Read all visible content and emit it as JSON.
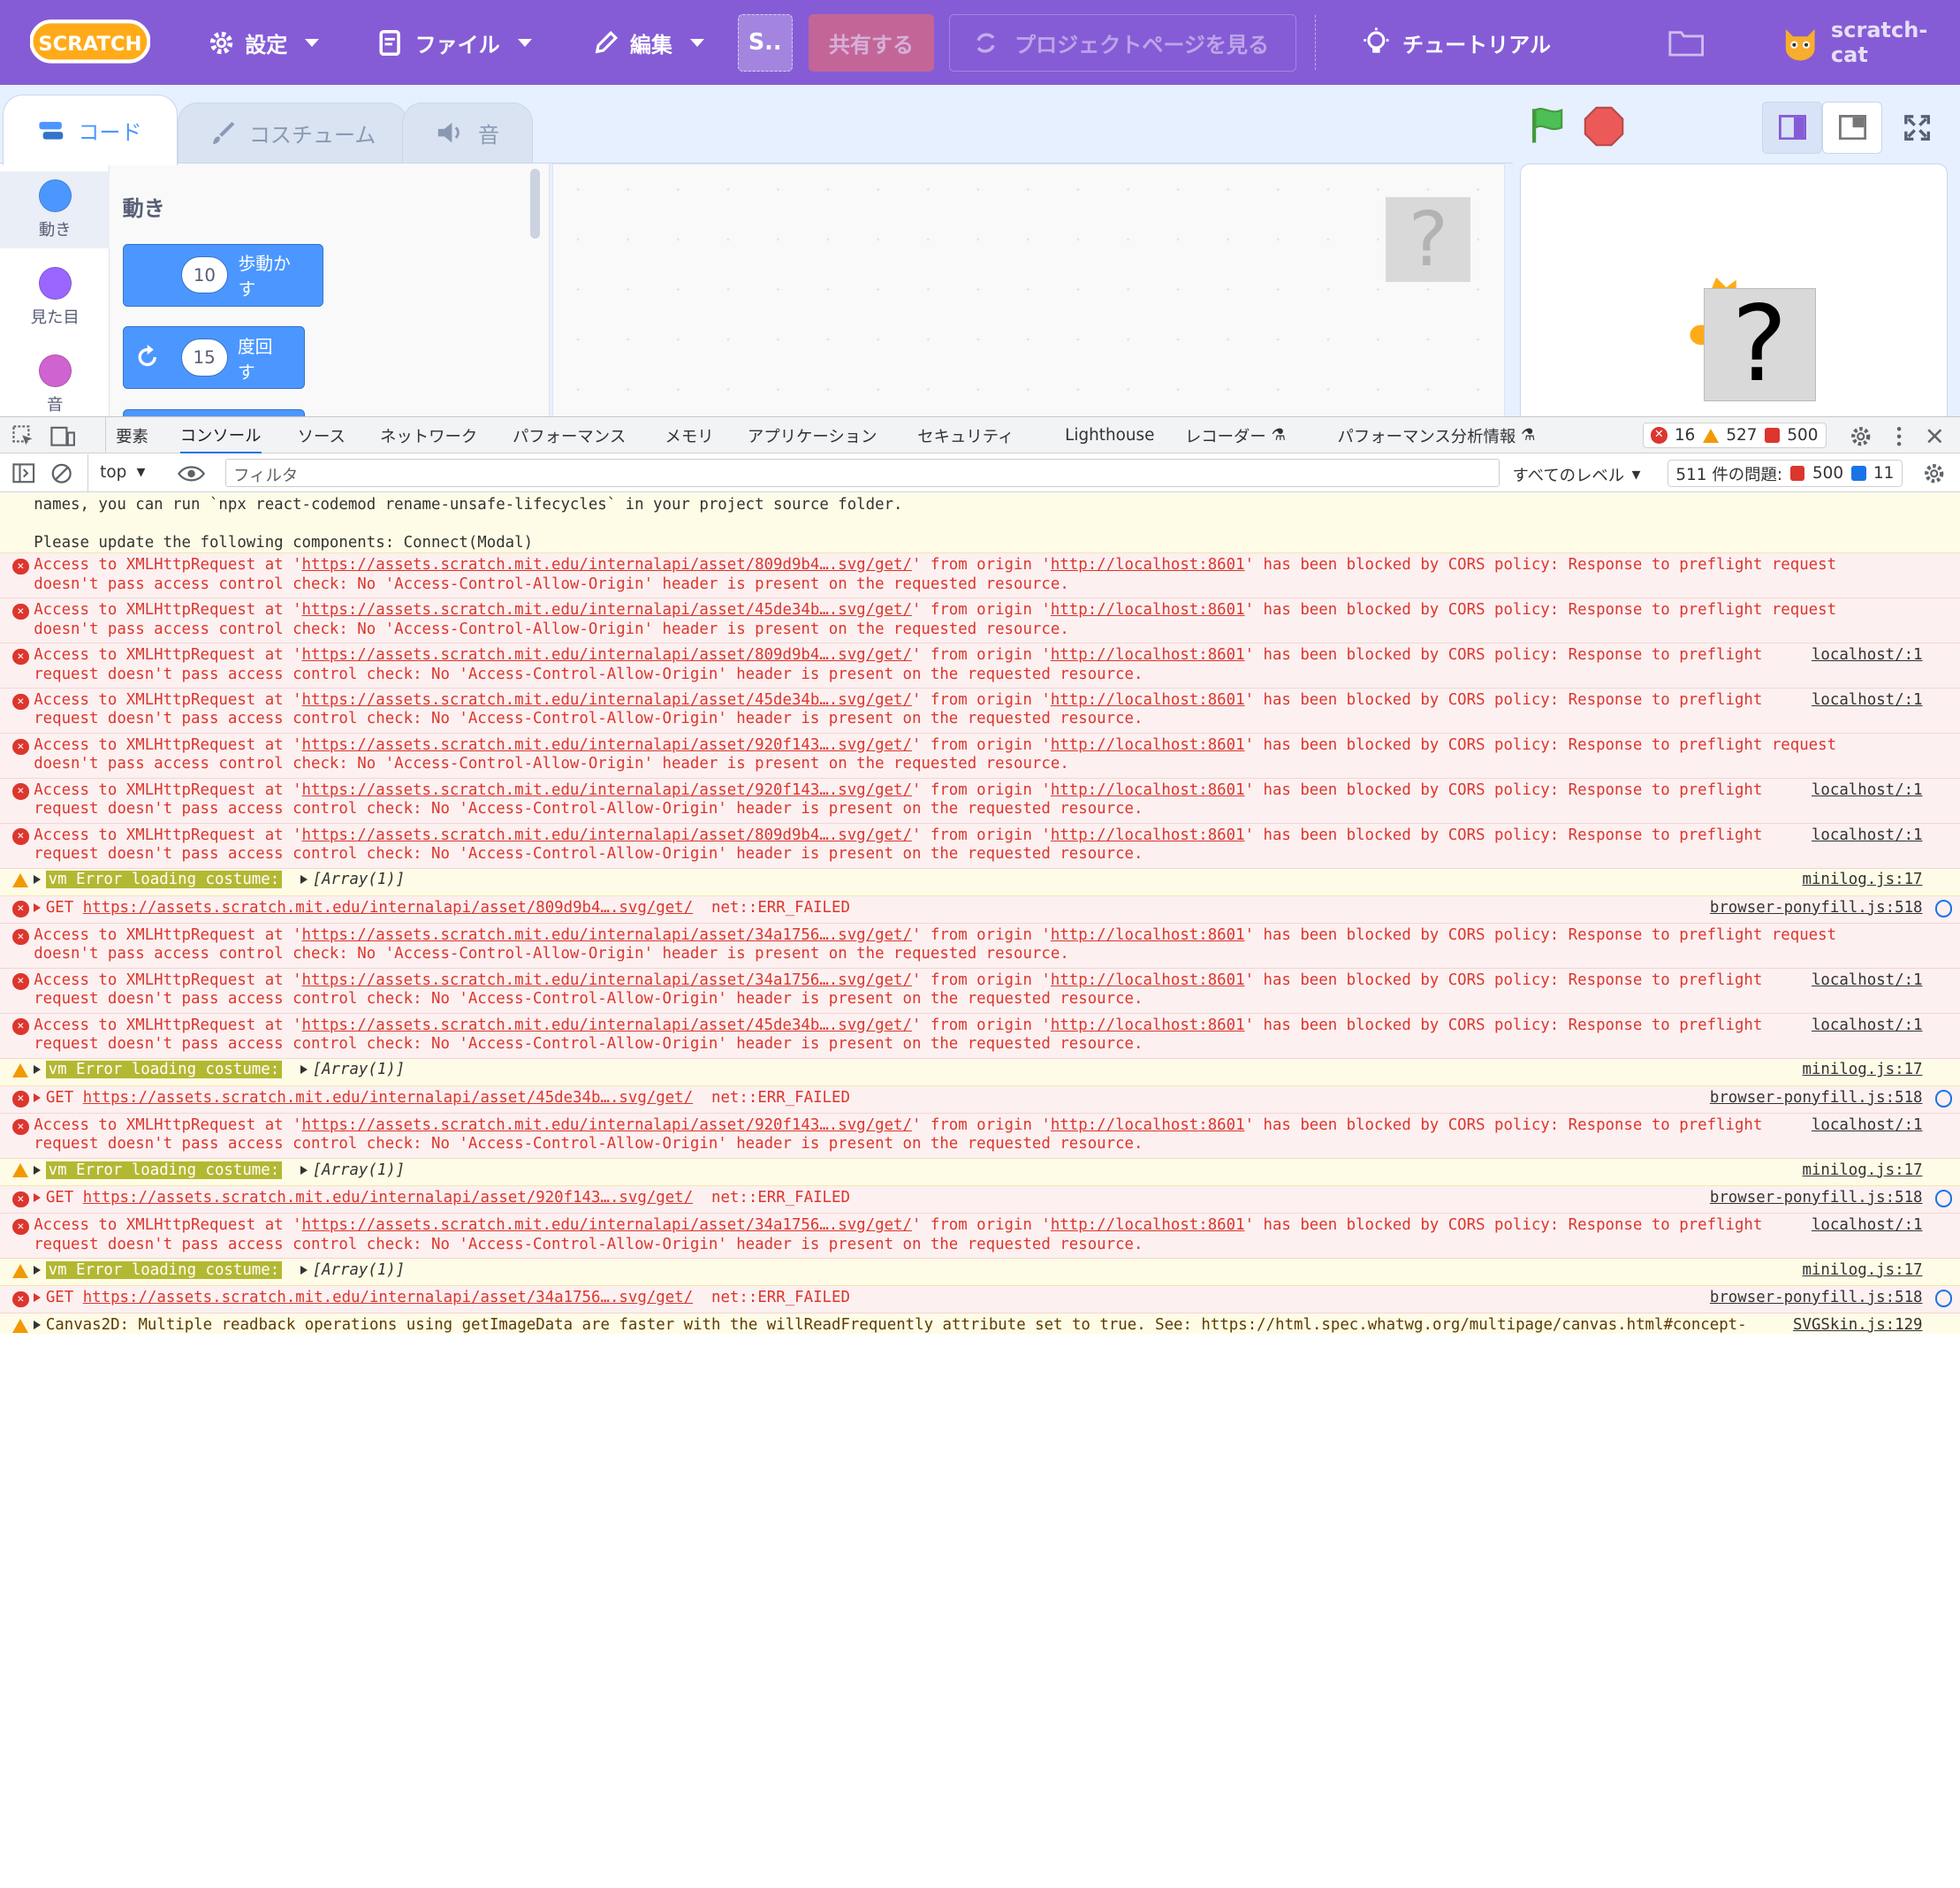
{
  "menubar": {
    "logo": "SCRATCH",
    "settings": "設定",
    "file": "ファイル",
    "edit": "編集",
    "project_short": "S..",
    "share": "共有する",
    "project_page": "プロジェクトページを見る",
    "tutorial": "チュートリアル",
    "username": "scratch-cat",
    "colors": {
      "bar": "#855cd6"
    }
  },
  "tabs": [
    "コード",
    "コスチューム",
    "音"
  ],
  "categories": [
    {
      "label": "動き",
      "color": "#4c97ff"
    },
    {
      "label": "見た目",
      "color": "#9966ff"
    },
    {
      "label": "音",
      "color": "#cf63cf"
    }
  ],
  "palette": {
    "title": "動き",
    "blocks": [
      {
        "num": "10",
        "label": "歩動かす"
      },
      {
        "num": "15",
        "label": "度回す"
      }
    ]
  },
  "placeholder_glyph": "?",
  "devtools": {
    "tabs": [
      "要素",
      "コンソール",
      "ソース",
      "ネットワーク",
      "パフォーマンス",
      "メモリ",
      "アプリケーション",
      "セキュリティ",
      "Lighthouse",
      "レコーダー",
      "パフォーマンス分析情報"
    ],
    "error_count": "16",
    "warning_count": "527",
    "issue_count": "500",
    "context": "top",
    "filter_placeholder": "フィルタ",
    "levels": "すべてのレベル",
    "issues_label": "511 件の問題:",
    "issues_red": "500",
    "issues_blue": "11"
  },
  "console": {
    "line0": "names, you can run `npx react-codemod rename-unsafe-lifecycles` in your project source folder.",
    "line1": "Please update the following components: Connect(Modal)",
    "vm_label": "vm Error loading costume:",
    "array_label": "[Array(1)]",
    "minilog": "minilog.js:17",
    "ponyfill": "browser-ponyfill.js:518",
    "localhost": "localhost/:1",
    "svgskin": "SVGSkin.js:129",
    "cors": [
      {
        "hash": "809d9b4…",
        "a": "' from origin '",
        "origin": "http://localhost:8601",
        "b": "' has been blocked by CORS policy: Response to preflight request",
        "c": "doesn't pass access control check: No 'Access-Control-Allow-Origin' header is present on the requested resource.",
        "src": ""
      },
      {
        "hash": "45de34b…",
        "a": "' from origin '",
        "origin": "http://localhost:8601",
        "b": "' has been blocked by CORS policy: Response to preflight request",
        "c": "doesn't pass access control check: No 'Access-Control-Allow-Origin' header is present on the requested resource.",
        "src": ""
      },
      {
        "hash": "809d9b4…",
        "a": "' from origin '",
        "origin": "http://localhost:8601",
        "b": "' has been blocked by CORS policy: Response to preflight",
        "c": "request doesn't pass access control check: No 'Access-Control-Allow-Origin' header is present on the requested resource.",
        "src": "localhost/:1"
      },
      {
        "hash": "45de34b…",
        "a": "' from origin '",
        "origin": "http://localhost:8601",
        "b": "' has been blocked by CORS policy: Response to preflight",
        "c": "request doesn't pass access control check: No 'Access-Control-Allow-Origin' header is present on the requested resource.",
        "src": "localhost/:1"
      },
      {
        "hash": "920f143…",
        "a": "' from origin '",
        "origin": "http://localhost:8601",
        "b": "' has been blocked by CORS policy: Response to preflight request",
        "c": "doesn't pass access control check: No 'Access-Control-Allow-Origin' header is present on the requested resource.",
        "src": ""
      },
      {
        "hash": "920f143…",
        "a": "' from origin '",
        "origin": "http://localhost:8601",
        "b": "' has been blocked by CORS policy: Response to preflight",
        "c": "request doesn't pass access control check: No 'Access-Control-Allow-Origin' header is present on the requested resource.",
        "src": "localhost/:1"
      },
      {
        "hash": "809d9b4…",
        "a": "' from origin '",
        "origin": "http://localhost:8601",
        "b": "' has been blocked by CORS policy: Response to preflight",
        "c": "request doesn't pass access control check: No 'Access-Control-Allow-Origin' header is present on the requested resource.",
        "src": "localhost/:1"
      }
    ],
    "access_prefix": "Access to XMLHttpRequest at '",
    "url_prefix": "https://assets.scratch.mit.edu/internalapi/asset/",
    "url_suffix": ".svg/get/",
    "get_prefix": "GET ",
    "net_failed": "net::ERR_FAILED",
    "canvas_line": "Canvas2D: Multiple readback operations using getImageData are faster with the willReadFrequently attribute set to true. See: https://html.spec.whatwg.org/multipage/canvas.html#concept-"
  }
}
